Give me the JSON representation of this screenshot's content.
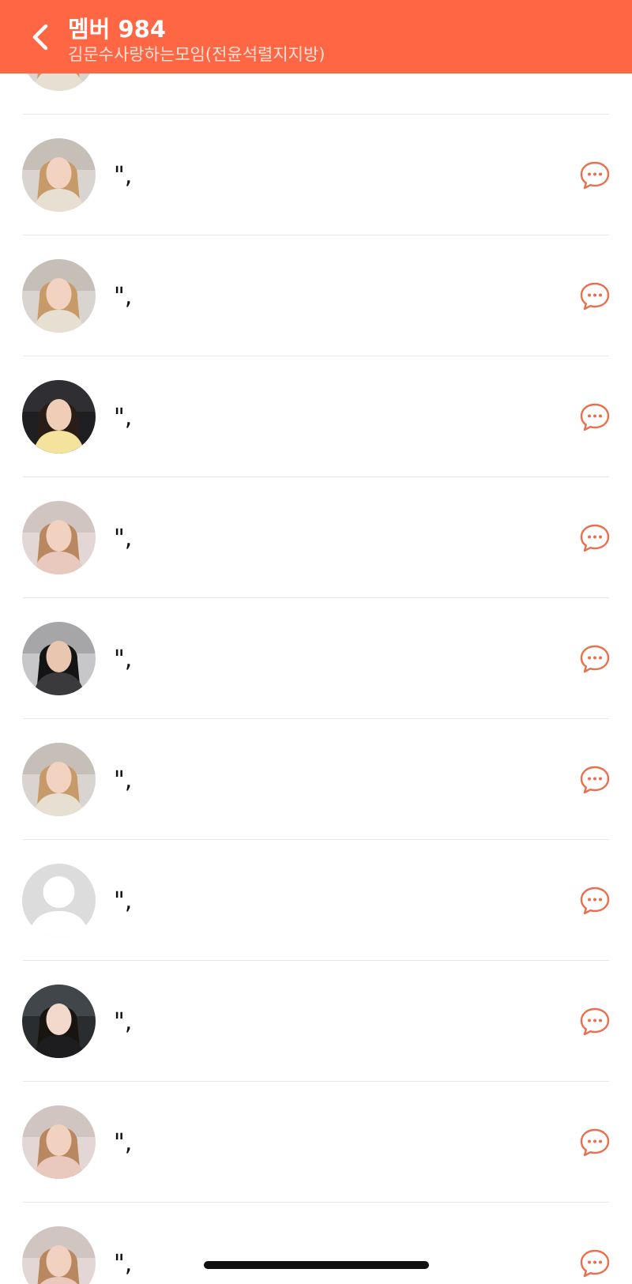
{
  "header": {
    "title": "멤버 984",
    "subtitle": "김문수사랑하는모임(전윤석렬지지방)",
    "back_icon": "chevron-left-icon",
    "background": "#ff6644"
  },
  "members": [
    {
      "name": "\",",
      "avatar": "photo-blossom-blonde"
    },
    {
      "name": "\",",
      "avatar": "photo-blossom-blonde"
    },
    {
      "name": "\",",
      "avatar": "photo-blossom-blonde"
    },
    {
      "name": "\",",
      "avatar": "photo-car-yellow"
    },
    {
      "name": "\",",
      "avatar": "photo-blossom-pink"
    },
    {
      "name": "\",",
      "avatar": "photo-dark-hair-grey"
    },
    {
      "name": "\",",
      "avatar": "photo-blossom-blonde"
    },
    {
      "name": "\",",
      "avatar": "default-avatar"
    },
    {
      "name": "\",",
      "avatar": "photo-car-dark"
    },
    {
      "name": "\",",
      "avatar": "photo-blossom-pink"
    },
    {
      "name": "\",",
      "avatar": "photo-blossom-pink"
    }
  ],
  "chat_icon": "chat-bubble-icon",
  "accent_color": "#ff6644"
}
